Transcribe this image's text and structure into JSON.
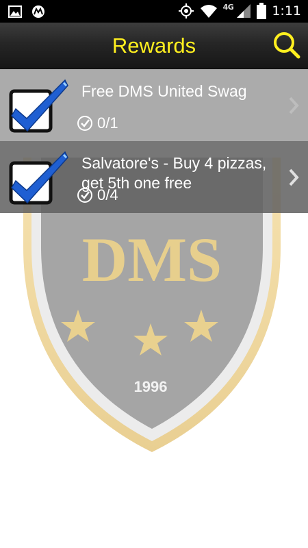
{
  "status_bar": {
    "time": "1:11",
    "network": "4G",
    "icons": [
      "image-icon",
      "motorola-icon",
      "gps-icon",
      "wifi-icon",
      "signal-icon",
      "battery-icon"
    ]
  },
  "header": {
    "title": "Rewards",
    "title_color": "#ffef1f",
    "search_icon": "search-icon"
  },
  "background": {
    "emblem_text": "DMS",
    "emblem_year": "1996"
  },
  "rewards": [
    {
      "title": "Free DMS United Swag",
      "progress": "0/1"
    },
    {
      "title": "Salvatore's - Buy 4 pizzas, get 5th one free",
      "progress": "0/4"
    }
  ]
}
